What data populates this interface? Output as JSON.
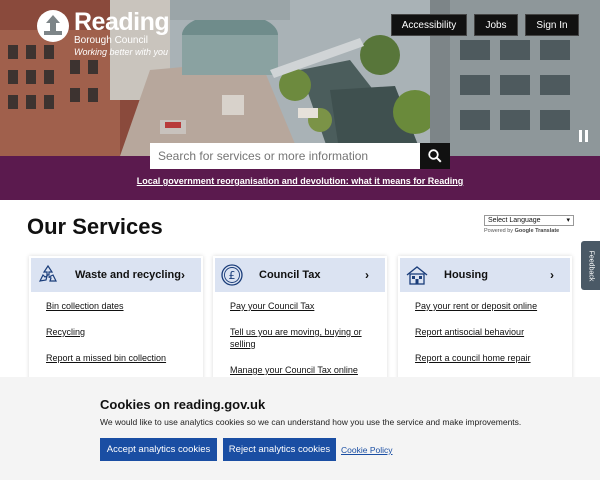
{
  "header": {
    "logo_name": "Reading",
    "logo_sub": "Borough Council",
    "logo_tagline": "Working better with you",
    "nav": [
      {
        "label": "Accessibility"
      },
      {
        "label": "Jobs"
      },
      {
        "label": "Sign In"
      }
    ]
  },
  "search": {
    "placeholder": "Search for services or more information",
    "button_icon": "search-icon"
  },
  "banner": {
    "link": "Local government reorganisation and devolution: what it means for Reading"
  },
  "services": {
    "title": "Our Services",
    "language_select": "Select Language",
    "powered_prefix": "Powered by",
    "powered_brand": "Google",
    "powered_suffix": "Translate",
    "feedback": "Feedback",
    "cards": [
      {
        "title": "Waste and recycling",
        "icon": "recycling-icon",
        "links": [
          "Bin collection dates",
          "Recycling",
          "Report a missed bin collection"
        ]
      },
      {
        "title": "Council Tax",
        "icon": "pound-coin-icon",
        "links": [
          "Pay your Council Tax",
          "Tell us you are moving, buying or selling",
          "Manage your Council Tax online"
        ]
      },
      {
        "title": "Housing",
        "icon": "house-icon",
        "links": [
          "Pay your rent or deposit online",
          "Report antisocial behaviour",
          "Report a council home repair"
        ]
      }
    ]
  },
  "cookies": {
    "title": "Cookies on reading.gov.uk",
    "text": "We would like to use analytics cookies so we can understand how you use the service and make improvements.",
    "accept": "Accept analytics cookies",
    "reject": "Reject analytics cookies",
    "policy": "Cookie Policy"
  },
  "colors": {
    "banner": "#5b1a4e",
    "card_head": "#dbe3f2",
    "button_blue": "#1a4ea3",
    "nav_black": "#111111"
  }
}
